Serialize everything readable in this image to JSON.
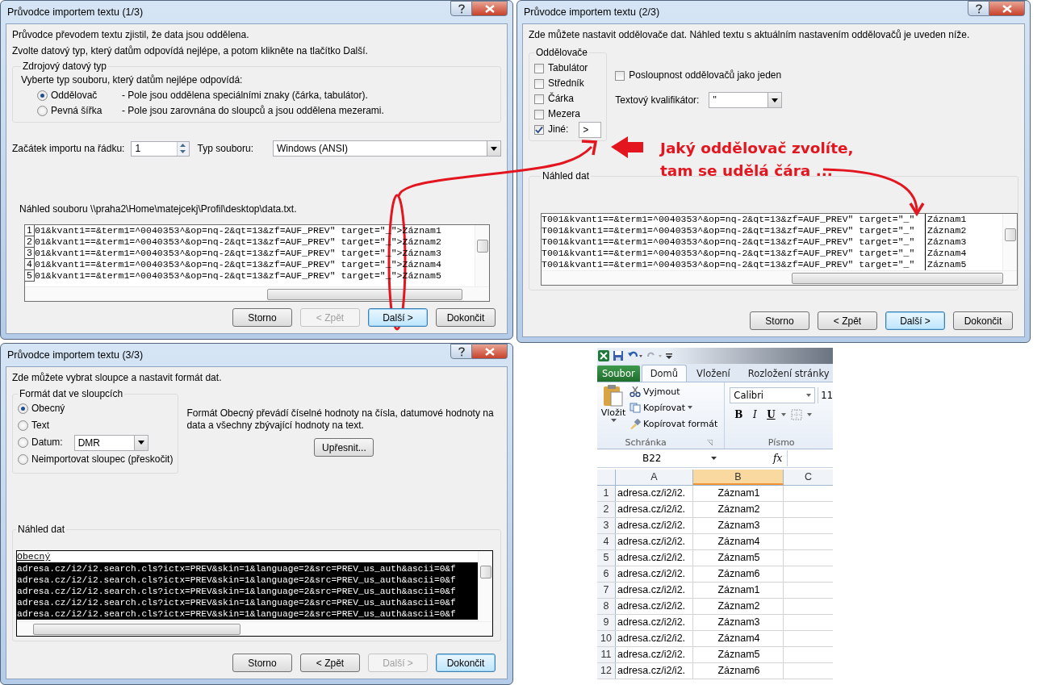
{
  "wizard_step1": {
    "title": "Průvodce importem textu (1/3)",
    "intro": [
      "Průvodce převodem textu zjistil, že data jsou oddělena.",
      "Zvolte datový typ, který datům odpovídá nejlépe, a potom klikněte na tlačítko Další."
    ],
    "source_type": {
      "title": "Zdrojový datový typ",
      "prompt": "Vyberte typ souboru, který datům nejlépe odpovídá:",
      "options": [
        {
          "label": "Oddělovač",
          "description": "- Pole jsou oddělena speciálními znaky (čárka, tabulátor).",
          "selected": true
        },
        {
          "label": "Pevná šířka",
          "description": "- Pole jsou zarovnána do sloupců a jsou oddělena mezerami.",
          "selected": false
        }
      ]
    },
    "start_row": {
      "label": "Začátek importu na řádku:",
      "value": "1"
    },
    "file_type": {
      "label": "Typ souboru:",
      "value": "Windows (ANSI)"
    },
    "preview": {
      "label": "Náhled souboru \\\\praha2\\Home\\matejcekj\\Profil\\desktop\\data.txt.",
      "rows": [
        {
          "number": "1",
          "text": "01&kvant1==&term1=^0040353^&op=nq-2&qt=13&zf=AUF_PREV\" target=\"_\">Záznam1"
        },
        {
          "number": "2",
          "text": "01&kvant1==&term1=^0040353^&op=nq-2&qt=13&zf=AUF_PREV\" target=\"_\">Záznam2"
        },
        {
          "number": "3",
          "text": "01&kvant1==&term1=^0040353^&op=nq-2&qt=13&zf=AUF_PREV\" target=\"_\">Záznam3"
        },
        {
          "number": "4",
          "text": "01&kvant1==&term1=^0040353^&op=nq-2&qt=13&zf=AUF_PREV\" target=\"_\">Záznam4"
        },
        {
          "number": "5",
          "text": "01&kvant1==&term1=^0040353^&op=nq-2&qt=13&zf=AUF_PREV\" target=\"_\">Záznam5"
        }
      ]
    },
    "buttons": [
      {
        "label": "Storno",
        "disabled": false,
        "default": false
      },
      {
        "label": "< Zpět",
        "disabled": true,
        "default": false
      },
      {
        "label": "Další >",
        "disabled": false,
        "default": true
      },
      {
        "label": "Dokončit",
        "disabled": false,
        "default": false
      }
    ]
  },
  "wizard_step2": {
    "title": "Průvodce importem textu (2/3)",
    "intro": "Zde můžete nastavit oddělovače dat. Náhled textu s aktuálním nastavením oddělovačů je uveden níže.",
    "delimiters": {
      "title": "Oddělovače",
      "options": [
        {
          "label": "Tabulátor",
          "checked": false
        },
        {
          "label": "Středník",
          "checked": false
        },
        {
          "label": "Čárka",
          "checked": false
        },
        {
          "label": "Mezera",
          "checked": false
        },
        {
          "label": "Jiné:",
          "checked": true,
          "value": ">"
        }
      ]
    },
    "consecutive": {
      "label": "Posloupnost oddělovačů jako jeden",
      "checked": false
    },
    "qualifier": {
      "label": "Textový kvalifikátor:",
      "value": "\""
    },
    "preview": {
      "title": "Náhled dat",
      "rows": [
        {
          "column_1": "T001&kvant1==&term1=^0040353^&op=nq-2&qt=13&zf=AUF_PREV\" target=\"_\"",
          "column_2": "Záznam1"
        },
        {
          "column_1": "T001&kvant1==&term1=^0040353^&op=nq-2&qt=13&zf=AUF_PREV\" target=\"_\"",
          "column_2": "Záznam2"
        },
        {
          "column_1": "T001&kvant1==&term1=^0040353^&op=nq-2&qt=13&zf=AUF_PREV\" target=\"_\"",
          "column_2": "Záznam3"
        },
        {
          "column_1": "T001&kvant1==&term1=^0040353^&op=nq-2&qt=13&zf=AUF_PREV\" target=\"_\"",
          "column_2": "Záznam4"
        },
        {
          "column_1": "T001&kvant1==&term1=^0040353^&op=nq-2&qt=13&zf=AUF_PREV\" target=\"_\"",
          "column_2": "Záznam5"
        }
      ]
    },
    "buttons": [
      {
        "label": "Storno",
        "disabled": false,
        "default": false
      },
      {
        "label": "< Zpět",
        "disabled": false,
        "default": false
      },
      {
        "label": "Další >",
        "disabled": false,
        "default": true
      },
      {
        "label": "Dokončit",
        "disabled": false,
        "default": false
      }
    ]
  },
  "annotation": {
    "lines": [
      "Jaký oddělovač zvolíte,",
      "tam se udělá čára ..."
    ]
  },
  "wizard_step3": {
    "title": "Průvodce importem textu (3/3)",
    "intro": "Zde můžete vybrat sloupce a nastavit formát dat.",
    "column_format": {
      "title": "Formát dat ve sloupcích",
      "options": [
        {
          "kind": "radio",
          "label": "Obecný",
          "selected": true
        },
        {
          "kind": "radio",
          "label": "Text",
          "selected": false
        },
        {
          "kind": "date",
          "label": "Datum:",
          "selected": false,
          "value": "DMR"
        },
        {
          "kind": "radio",
          "label": "Neimportovat sloupec (přeskočit)",
          "selected": false
        }
      ]
    },
    "description": "Formát Obecný převádí číselné hodnoty na čísla, datumové hodnoty na data a všechny zbývající hodnoty na text.",
    "advanced_button": "Upřesnit...",
    "preview": {
      "title": "Náhled dat",
      "columns": [
        {
          "header": "Obecný",
          "selected": true
        }
      ],
      "rows": [
        "adresa.cz/i2/i2.search.cls?ictx=PREV&skin=1&language=2&src=PREV_us_auth&ascii=0&f",
        "adresa.cz/i2/i2.search.cls?ictx=PREV&skin=1&language=2&src=PREV_us_auth&ascii=0&f",
        "adresa.cz/i2/i2.search.cls?ictx=PREV&skin=1&language=2&src=PREV_us_auth&ascii=0&f",
        "adresa.cz/i2/i2.search.cls?ictx=PREV&skin=1&language=2&src=PREV_us_auth&ascii=0&f",
        "adresa.cz/i2/i2.search.cls?ictx=PREV&skin=1&language=2&src=PREV_us_auth&ascii=0&f"
      ]
    },
    "buttons": [
      {
        "label": "Storno",
        "disabled": false,
        "default": false
      },
      {
        "label": "< Zpět",
        "disabled": false,
        "default": false
      },
      {
        "label": "Další >",
        "disabled": true,
        "default": false
      },
      {
        "label": "Dokončit",
        "disabled": false,
        "default": true
      }
    ]
  },
  "excel": {
    "tabs": [
      {
        "kind": "file",
        "label": "Soubor",
        "selected": false
      },
      {
        "kind": "tab",
        "label": "Domů",
        "selected": true
      },
      {
        "kind": "tab",
        "label": "Vložení",
        "selected": false
      },
      {
        "kind": "tab",
        "label": "Rozložení stránky",
        "selected": false
      }
    ],
    "clipboard": {
      "paste": "Vložit",
      "cut": "Vyjmout",
      "copy": "Kopírovat",
      "format_painter": "Kopírovat formát",
      "label": "Schránka"
    },
    "font": {
      "name": "Calibri",
      "size": "11",
      "bold": "B",
      "italic": "I",
      "underline": "U",
      "label": "Písmo"
    },
    "name_box": "B22",
    "function_button": "fx",
    "columns": [
      {
        "label": "A",
        "selected": false
      },
      {
        "label": "B",
        "selected": true
      },
      {
        "label": "C",
        "selected": false
      }
    ],
    "rows": [
      {
        "number": "1",
        "column_a": "adresa.cz/i2/i2.",
        "column_b": "Záznam1"
      },
      {
        "number": "2",
        "column_a": "adresa.cz/i2/i2.",
        "column_b": "Záznam2"
      },
      {
        "number": "3",
        "column_a": "adresa.cz/i2/i2.",
        "column_b": "Záznam3"
      },
      {
        "number": "4",
        "column_a": "adresa.cz/i2/i2.",
        "column_b": "Záznam4"
      },
      {
        "number": "5",
        "column_a": "adresa.cz/i2/i2.",
        "column_b": "Záznam5"
      },
      {
        "number": "6",
        "column_a": "adresa.cz/i2/i2.",
        "column_b": "Záznam6"
      },
      {
        "number": "7",
        "column_a": "adresa.cz/i2/i2.",
        "column_b": "Záznam1"
      },
      {
        "number": "8",
        "column_a": "adresa.cz/i2/i2.",
        "column_b": "Záznam2"
      },
      {
        "number": "9",
        "column_a": "adresa.cz/i2/i2.",
        "column_b": "Záznam3"
      },
      {
        "number": "10",
        "column_a": "adresa.cz/i2/i2.",
        "column_b": "Záznam4"
      },
      {
        "number": "11",
        "column_a": "adresa.cz/i2/i2.",
        "column_b": "Záznam5"
      },
      {
        "number": "12",
        "column_a": "adresa.cz/i2/i2.",
        "column_b": "Záznam6"
      }
    ]
  }
}
